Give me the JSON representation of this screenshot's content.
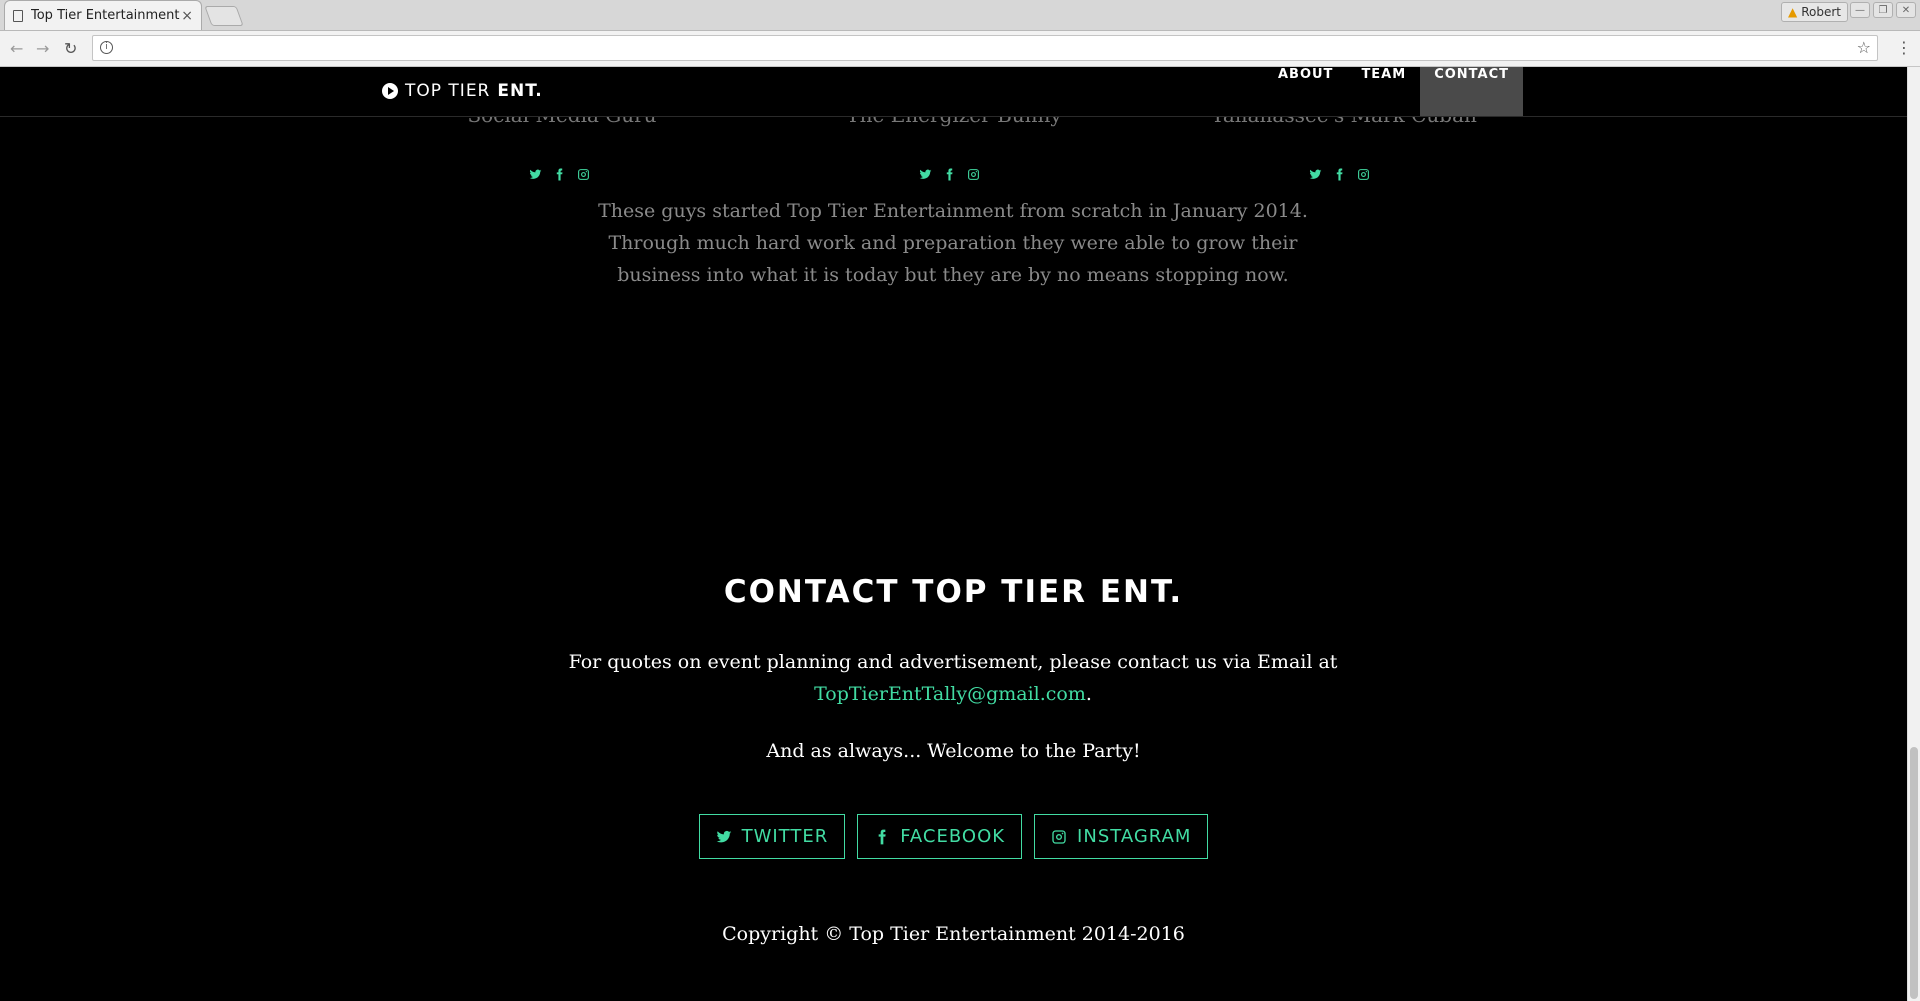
{
  "browser": {
    "tab_title": "Top Tier Entertainment",
    "tab_close": "×",
    "profile_name": "Robert",
    "address": "",
    "window_controls": [
      "—",
      "❐",
      "✕"
    ]
  },
  "nav": {
    "brand_part1": "TOP TIER",
    "brand_part2": "ENT.",
    "links": [
      "ABOUT",
      "TEAM",
      "CONTACT"
    ],
    "active": "CONTACT"
  },
  "team": {
    "roles": [
      "Social Media Guru",
      "The Energizer Bunny",
      "Tallahassee's Mark Cuban"
    ],
    "social_icons": [
      "twitter-icon",
      "facebook-icon",
      "instagram-icon"
    ],
    "about": "These guys started Top Tier Entertainment from scratch in January 2014. Through much hard work and preparation they were able to grow their business into what it is today but they are by no means stopping now."
  },
  "contact": {
    "title": "CONTACT TOP TIER ENT.",
    "text_before": "For quotes on event planning and advertisement, please contact us via Email at",
    "email": "TopTierEntTally@gmail.com",
    "text_after": ".",
    "tagline": "And as always... Welcome to the Party!",
    "buttons": [
      "TWITTER",
      "FACEBOOK",
      "INSTAGRAM"
    ]
  },
  "footer": {
    "copyright": "Copyright © Top Tier Entertainment 2014-2016"
  },
  "colors": {
    "accent": "#42dca3",
    "background": "#000000",
    "nav_active": "#4a4a4a"
  }
}
